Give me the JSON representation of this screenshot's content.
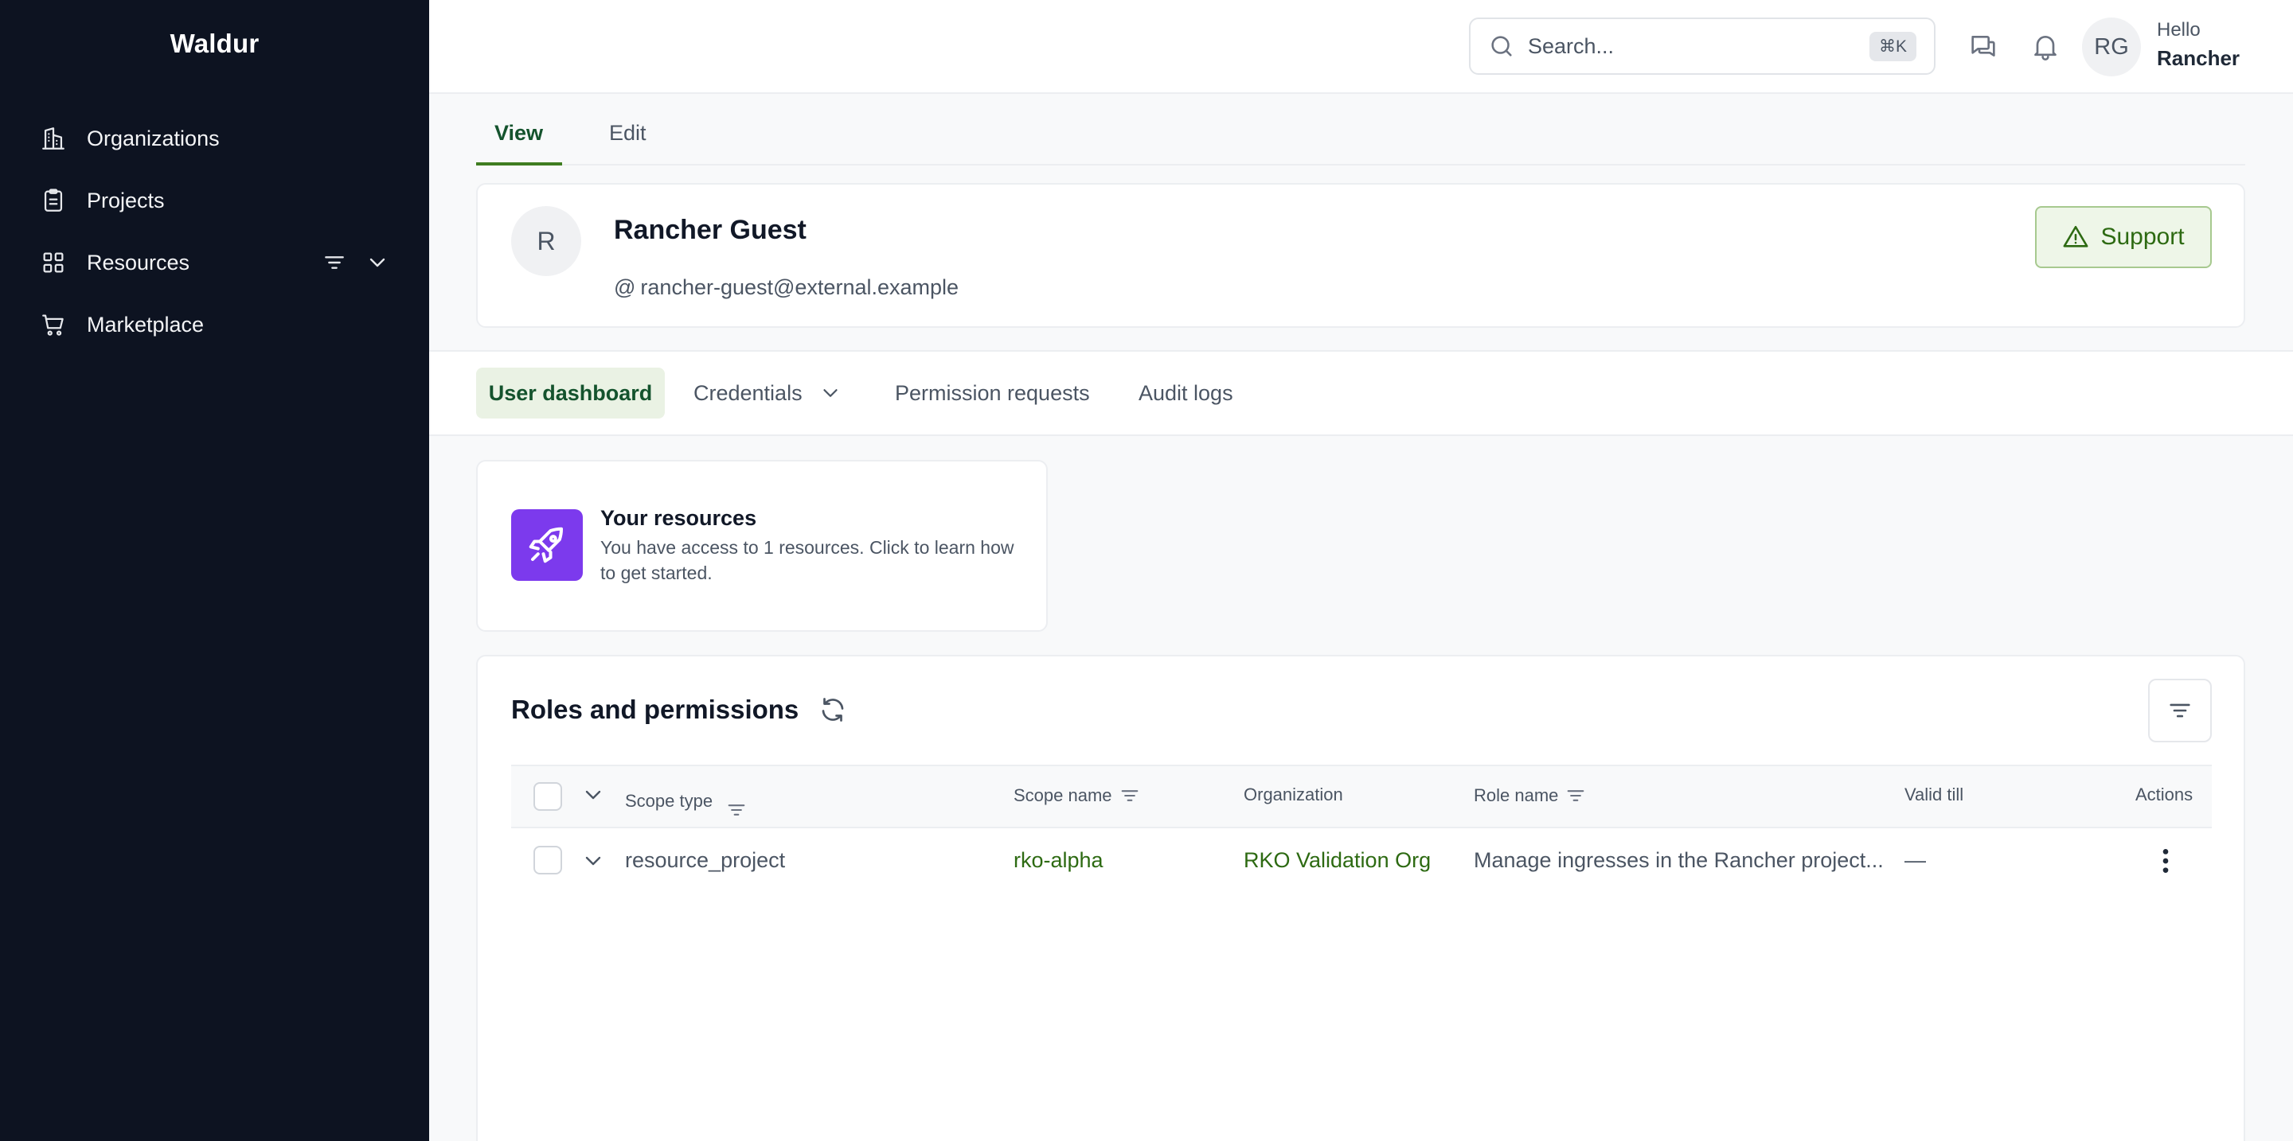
{
  "sidebar": {
    "brand": "Waldur",
    "items": [
      {
        "label": "Organizations",
        "icon": "building-icon"
      },
      {
        "label": "Projects",
        "icon": "clipboard-icon"
      },
      {
        "label": "Resources",
        "icon": "grid-icon"
      },
      {
        "label": "Marketplace",
        "icon": "cart-icon"
      }
    ]
  },
  "header": {
    "search_placeholder": "Search...",
    "search_shortcut": "⌘K",
    "avatar_initials": "RG",
    "greeting": "Hello",
    "user_first_name": "Rancher"
  },
  "profile_tabs": [
    "View",
    "Edit"
  ],
  "profile": {
    "avatar_initial": "R",
    "name": "Rancher Guest",
    "email_prefix": "@",
    "email": "rancher-guest@external.example",
    "support_label": "Support"
  },
  "sub_tabs": [
    "User dashboard",
    "Credentials",
    "Permission requests",
    "Audit logs"
  ],
  "resources_card": {
    "title": "Your resources",
    "description": "You have access to 1 resources. Click to learn how to get started."
  },
  "roles": {
    "title": "Roles and permissions",
    "columns": {
      "scope_type": "Scope type",
      "scope_name": "Scope name",
      "organization": "Organization",
      "role_name": "Role name",
      "valid_till": "Valid till",
      "actions": "Actions"
    },
    "rows": [
      {
        "scope_type": "resource_project",
        "scope_name": "rko-alpha",
        "organization": "RKO Validation Org",
        "role_name": "Manage ingresses in the Rancher project...",
        "valid_till": "—"
      }
    ]
  },
  "colors": {
    "sidebar_bg": "#0d1321",
    "accent_green": "#3f7d20",
    "rocket_purple": "#7c3aed"
  }
}
